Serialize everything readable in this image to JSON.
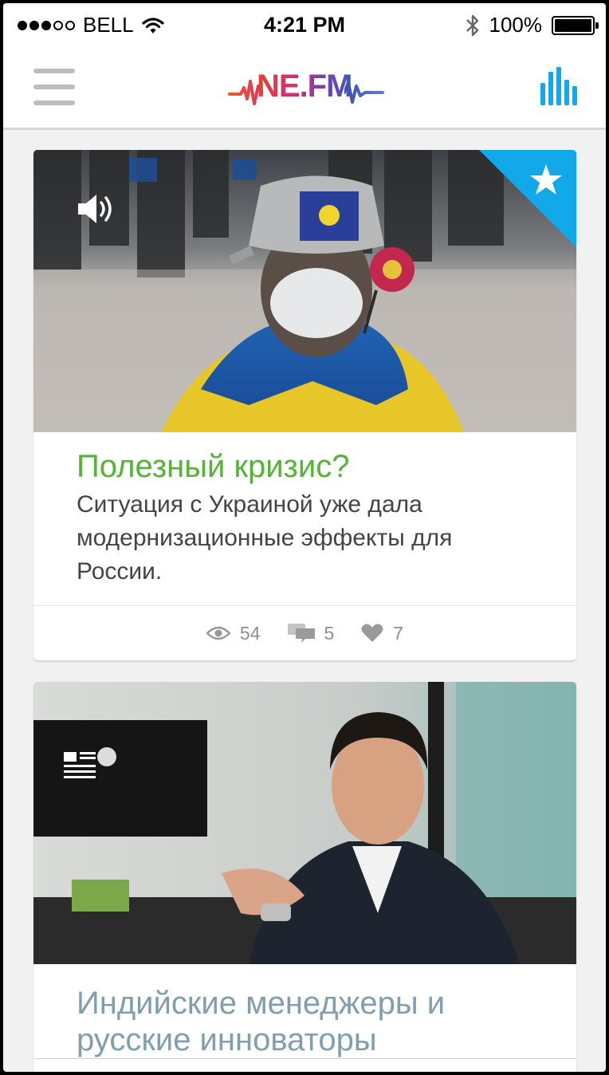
{
  "status_bar": {
    "carrier": "BELL",
    "time": "4:21 PM",
    "battery": "100%",
    "signal_dots_filled": 3,
    "signal_dots_total": 5
  },
  "header": {
    "logo": "NE.FM",
    "menu_icon": "hamburger-icon",
    "stats_icon": "equalizer-icon"
  },
  "colors": {
    "accent_blue": "#11a9e9",
    "title_green": "#55b337",
    "title_blue_gray": "#7f9fae",
    "menu_gray": "#bdbdbd"
  },
  "feed": [
    {
      "type_icon": "audio-icon",
      "badge_icon": "star-icon",
      "title": "Полезный кризис?",
      "description": "Ситуация с Украиной уже дала модернизационные эффекты для России.",
      "views": "54",
      "comments": "5",
      "likes": "7"
    },
    {
      "type_icon": "article-icon",
      "title": "Индийские менеджеры и русские инноваторы"
    }
  ]
}
